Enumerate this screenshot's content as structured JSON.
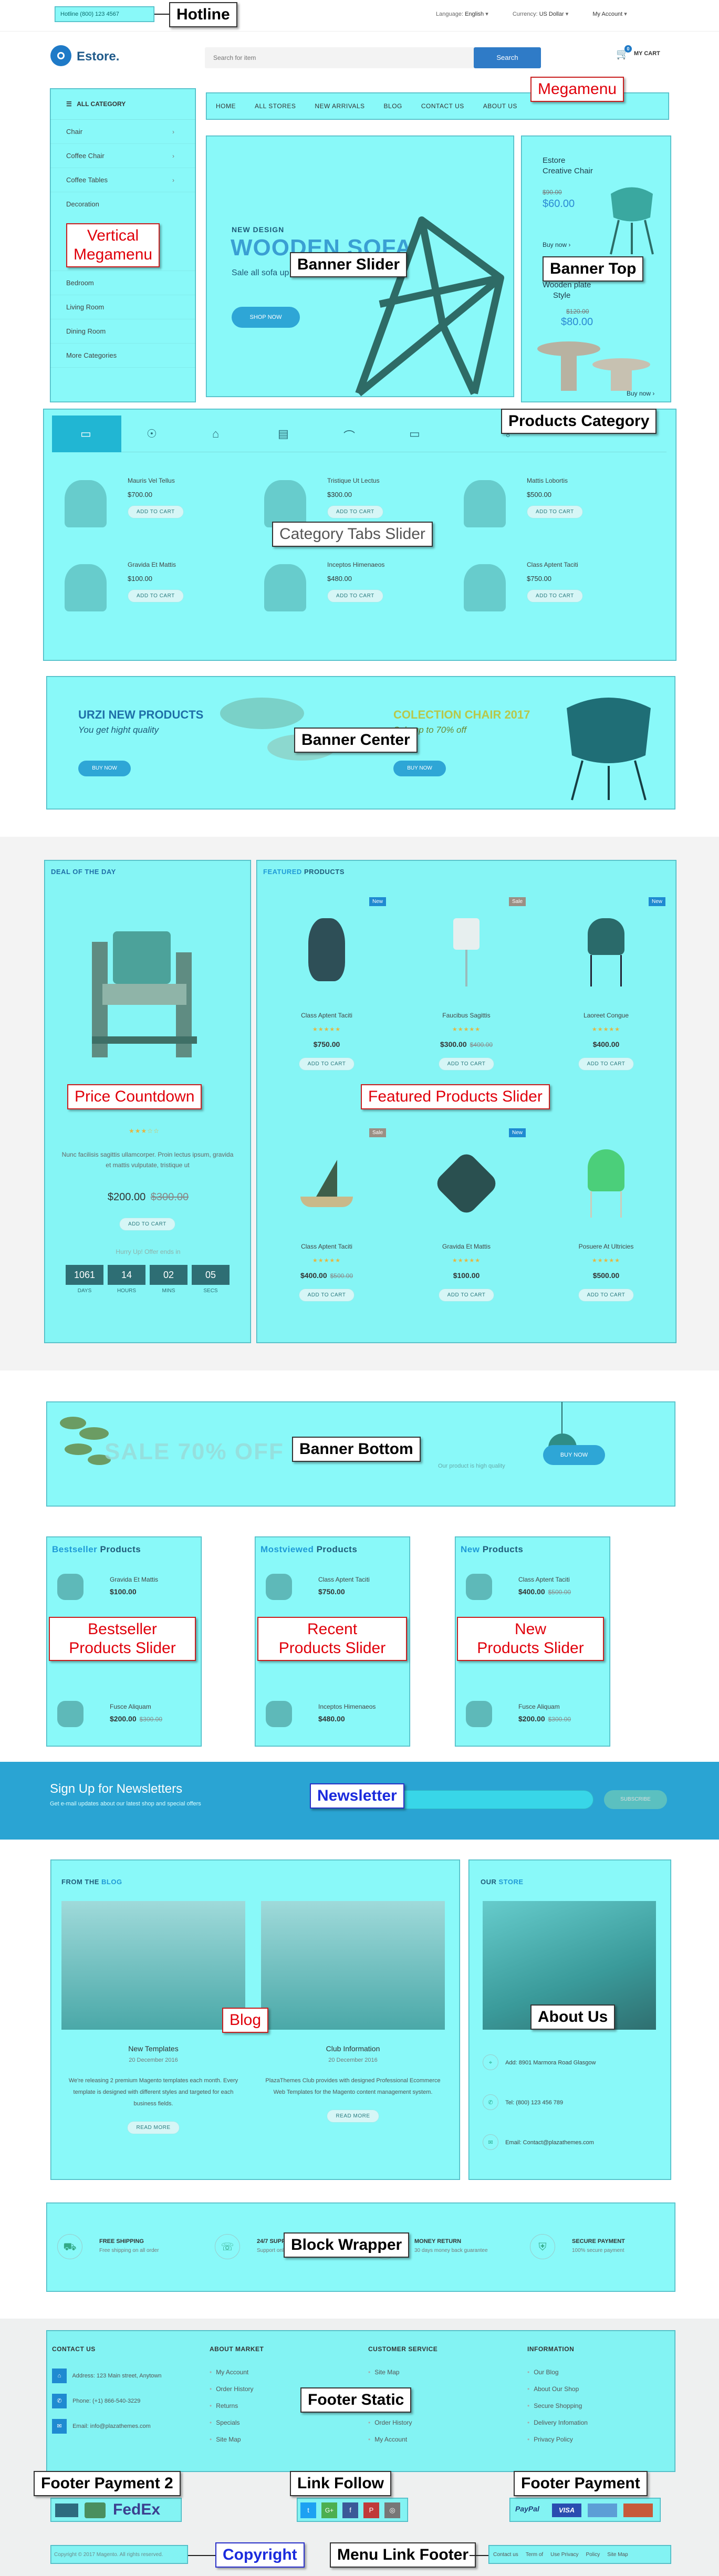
{
  "topbar": {
    "hotline_text": "Hotline (800) 123 4567",
    "language_label": "Language:",
    "language_value": "English",
    "currency_label": "Currency:",
    "currency_value": "US Dollar",
    "account": "My Account"
  },
  "header": {
    "logo_text": "Estore.",
    "search_placeholder": "Search for item",
    "search_button": "Search",
    "cart_label": "MY CART",
    "cart_count": "0"
  },
  "vertical_menu": {
    "title": "ALL CATEGORY",
    "items": [
      {
        "label": "Chair"
      },
      {
        "label": "Coffee Chair"
      },
      {
        "label": "Coffee Tables"
      },
      {
        "label": "Decoration"
      },
      {
        "label": "Bedroom"
      },
      {
        "label": "Living Room"
      },
      {
        "label": "Dining Room"
      },
      {
        "label": "More Categories"
      }
    ]
  },
  "megamenu": {
    "items": [
      {
        "label": "HOME"
      },
      {
        "label": "ALL STORES"
      },
      {
        "label": "NEW ARRIVALS"
      },
      {
        "label": "BLOG"
      },
      {
        "label": "CONTACT US"
      },
      {
        "label": "ABOUT US"
      }
    ]
  },
  "banner_slider": {
    "kicker": "NEW DESIGN",
    "title": "WOODEN SOFA",
    "subtitle": "Sale all sofa up to 70%",
    "button": "SHOP NOW"
  },
  "banner_top": {
    "item1_title_1": "Estore",
    "item1_title_2": "Creative Chair",
    "item1_old_price": "$90.00",
    "item1_price": "$60.00",
    "item1_link": "Buy now",
    "item2_title_1": "Wooden plate",
    "item2_title_2": "Style",
    "item2_old_price": "$120.00",
    "item2_price": "$80.00",
    "item2_link": "Buy now"
  },
  "products_category": {
    "rows": [
      [
        {
          "name": "Mauris Vel Tellus",
          "price": "$700.00",
          "button": "ADD TO CART"
        },
        {
          "name": "Tristique Ut Lectus",
          "price": "$300.00",
          "button": "ADD TO CART"
        },
        {
          "name": "Mattis Lobortis",
          "price": "$500.00",
          "button": "ADD TO CART"
        }
      ],
      [
        {
          "name": "Gravida Et Mattis",
          "price": "$100.00",
          "button": "ADD TO CART"
        },
        {
          "name": "Inceptos Himenaeos",
          "price": "$480.00",
          "button": "ADD TO CART"
        },
        {
          "name": "Class Aptent Taciti",
          "price": "$750.00",
          "button": "ADD TO CART"
        }
      ]
    ]
  },
  "banner_center": {
    "left_title": "URZI NEW PRODUCTS",
    "left_sub": "You get hight quality",
    "left_button": "BUY NOW",
    "right_title": "COLECTION CHAIR 2017",
    "right_sub": "Sale up to 70% off",
    "right_button": "BUY NOW"
  },
  "deal": {
    "title_a": "DEAL OF THE DAY",
    "desc": "Nunc facilisis sagittis ullamcorper. Proin lectus ipsum, gravida et mattis vulputate, tristique ut",
    "price": "$200.00",
    "old_price": "$300.00",
    "button": "ADD TO CART",
    "hurry": "Hurry Up! Offer ends in",
    "countdown": [
      {
        "value": "1061",
        "unit": "DAYS"
      },
      {
        "value": "14",
        "unit": "HOURS"
      },
      {
        "value": "02",
        "unit": "MINS"
      },
      {
        "value": "05",
        "unit": "SECS"
      }
    ]
  },
  "featured": {
    "title_a": "FEATURED",
    "title_b": "PRODUCTS",
    "products": [
      {
        "name": "Class Aptent Taciti",
        "price": "$750.00",
        "old": "",
        "tag": "New",
        "button": "ADD TO CART"
      },
      {
        "name": "Faucibus Sagittis",
        "price": "$300.00",
        "old": "$400.00",
        "tag": "Sale",
        "button": "ADD TO CART"
      },
      {
        "name": "Laoreet Congue",
        "price": "$400.00",
        "old": "",
        "tag": "New",
        "button": "ADD TO CART"
      },
      {
        "name": "Class Aptent Taciti",
        "price": "$400.00",
        "old": "$500.00",
        "tag": "Sale",
        "button": "ADD TO CART"
      },
      {
        "name": "Gravida Et Mattis",
        "price": "$100.00",
        "old": "",
        "tag": "New",
        "button": "ADD TO CART"
      },
      {
        "name": "Posuere At Ultricies",
        "price": "$500.00",
        "old": "",
        "tag": "",
        "button": "ADD TO CART"
      }
    ]
  },
  "banner_bottom": {
    "text": "SALE 70% OFF FOR YOU",
    "sub": "Our product is high quality",
    "button": "BUY NOW"
  },
  "bestseller": {
    "title_a": "Bestseller",
    "title_b": "Products",
    "items": [
      {
        "name": "Gravida Et Mattis",
        "price": "$100.00",
        "old": ""
      },
      {
        "name": "Fusce Aliquam",
        "price": "$200.00",
        "old": "$300.00"
      }
    ]
  },
  "mostviewed": {
    "title_a": "Mostviewed",
    "title_b": "Products",
    "items": [
      {
        "name": "Class Aptent Taciti",
        "price": "$750.00",
        "old": ""
      },
      {
        "name": "Inceptos Himenaeos",
        "price": "$480.00",
        "old": ""
      }
    ]
  },
  "newproducts": {
    "title_a": "New",
    "title_b": "Products",
    "items": [
      {
        "name": "Class Aptent Taciti",
        "price": "$400.00",
        "old": "$500.00"
      },
      {
        "name": "Fusce Aliquam",
        "price": "$200.00",
        "old": "$300.00"
      }
    ]
  },
  "newsletter": {
    "title": "Sign Up for Newsletters",
    "sub": "Get e-mail updates about our latest shop and special offers",
    "placeholder": "",
    "button": "SUBSCRIBE"
  },
  "blog": {
    "title_a": "FROM THE",
    "title_b": "BLOG",
    "posts": [
      {
        "title": "New Templates",
        "date": "20 December 2016",
        "text": "We're releasing 2 premium Magento templates each month. Every template is designed with different styles and targeted for each business fields.",
        "button": "READ MORE"
      },
      {
        "title": "Club Information",
        "date": "20 December 2016",
        "text": "PlazaThemes Club provides with designed Professional Ecommerce Web Templates for the Magento content management system.",
        "button": "READ MORE"
      }
    ]
  },
  "about": {
    "title_a": "OUR",
    "title_b": "STORE",
    "address": "Add: 8901 Marmora Road Glasgow",
    "tel": "Tel: (800) 123 456 789",
    "email": "Email: Contact@plazathemes.com"
  },
  "block_wrapper": [
    {
      "title": "FREE SHIPPING",
      "sub": "Free shipping on all order"
    },
    {
      "title": "24/7 SUPPORT",
      "sub": "Support online 24 hours"
    },
    {
      "title": "MONEY RETURN",
      "sub": "30 days money back guarantee"
    },
    {
      "title": "SECURE PAYMENT",
      "sub": "100% secure payment"
    }
  ],
  "footer": {
    "contact_title": "CONTACT US",
    "contact_addr": "Address: 123 Main street, Anytown",
    "contact_phone": "Phone: (+1) 866-540-3229",
    "contact_email": "Email: info@plazathemes.com",
    "col2_title": "ABOUT MARKET",
    "col2": [
      "My Account",
      "Order History",
      "Returns",
      "Specials",
      "Site Map"
    ],
    "col3_title": "CUSTOMER SERVICE",
    "col3": [
      "Site Map",
      "",
      "",
      "Order History",
      "My Account"
    ],
    "col4_title": "INFORMATION",
    "col4": [
      "Our Blog",
      "About Our Shop",
      "Secure Shopping",
      "Delivery Infomation",
      "Privacy Policy"
    ],
    "copyright": "Copyright © 2017 Magento. All rights reserved.",
    "links": [
      "Contact us",
      "Term of",
      "Use Privacy",
      "Policy",
      "Site Map"
    ]
  },
  "annotations": {
    "hotline": "Hotline",
    "megamenu": "Megamenu",
    "vertical": "Vertical\nMegamenu",
    "banner_slider": "Banner Slider",
    "banner_top": "Banner Top",
    "products_category": "Products Category",
    "category_tabs": "Category Tabs Slider",
    "banner_center": "Banner Center",
    "price_countdown": "Price Countdown",
    "featured_slider": "Featured Products Slider",
    "banner_bottom": "Banner Bottom",
    "bestseller_slider": "Bestseller\nProducts Slider",
    "recent_slider": "Recent\nProducts Slider",
    "new_slider": "New\nProducts Slider",
    "newsletter": "Newsletter",
    "blog": "Blog",
    "about": "About Us",
    "block_wrapper": "Block Wrapper",
    "footer_static": "Footer Static",
    "footer_payment2": "Footer Payment 2",
    "link_follow": "Link Follow",
    "footer_payment": "Footer Payment",
    "copyright": "Copyright",
    "menu_link_footer": "Menu Link Footer"
  }
}
